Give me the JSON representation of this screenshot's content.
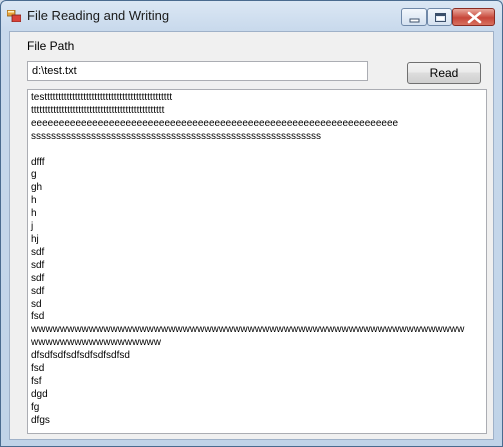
{
  "window": {
    "title": "File Reading and Writing"
  },
  "form": {
    "file_path_label": "File Path",
    "file_path_value": "d:\\test.txt",
    "read_button_label": "Read"
  },
  "textarea": {
    "content": "testttttttttttttttttttttttttttttttttttttttttttttt\ntttttttttttttttttttttttttttttttttttttttttttttttt\neeeeeeeeeeeeeeeeeeeeeeeeeeeeeeeeeeeeeeeeeeeeeeeeeeeeeeeeeeeeeeeeee\nssssssssssssssssssssssssssssssssssssssssssssssssssssssssss\n\ndfff\ng\ngh\nh\nh\nj\nhj\nsdf\nsdf\nsdf\nsdf\nsd\nfsd\nwwwwwwwwwwwwwwwwwwwwwwwwwwwwwwwwwwwwwwwwwwwwwwwwwwwwwwwwwwww\nwwwwwwwwwwwwwwwwww\ndfsdfsdfsdfsdfsdfsdfsd\nfsd\nfsf\ndgd\nfg\ndfgs"
  }
}
